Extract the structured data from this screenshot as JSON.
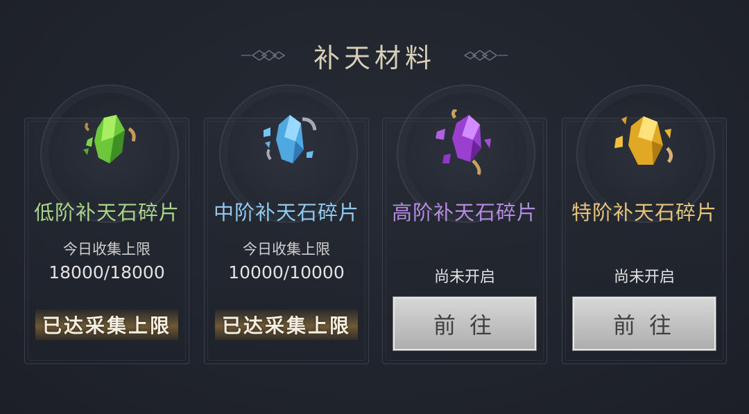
{
  "header": {
    "title": "补天材料"
  },
  "cards": [
    {
      "name": "低阶补天石碎片",
      "name_color": "#a9d48a",
      "gem_icon": "green-crystal-icon",
      "limit_label": "今日收集上限",
      "limit_value": "18000/18000",
      "reached_text": "已达采集上限"
    },
    {
      "name": "中阶补天石碎片",
      "name_color": "#8fc8f0",
      "gem_icon": "blue-crystal-icon",
      "limit_label": "今日收集上限",
      "limit_value": "10000/10000",
      "reached_text": "已达采集上限"
    },
    {
      "name": "高阶补天石碎片",
      "name_color": "#b58ae0",
      "gem_icon": "purple-crystal-icon",
      "status_text": "尚未开启",
      "button_label": "前往"
    },
    {
      "name": "特阶补天石碎片",
      "name_color": "#e6c37a",
      "gem_icon": "gold-crystal-icon",
      "status_text": "尚未开启",
      "button_label": "前往"
    }
  ]
}
